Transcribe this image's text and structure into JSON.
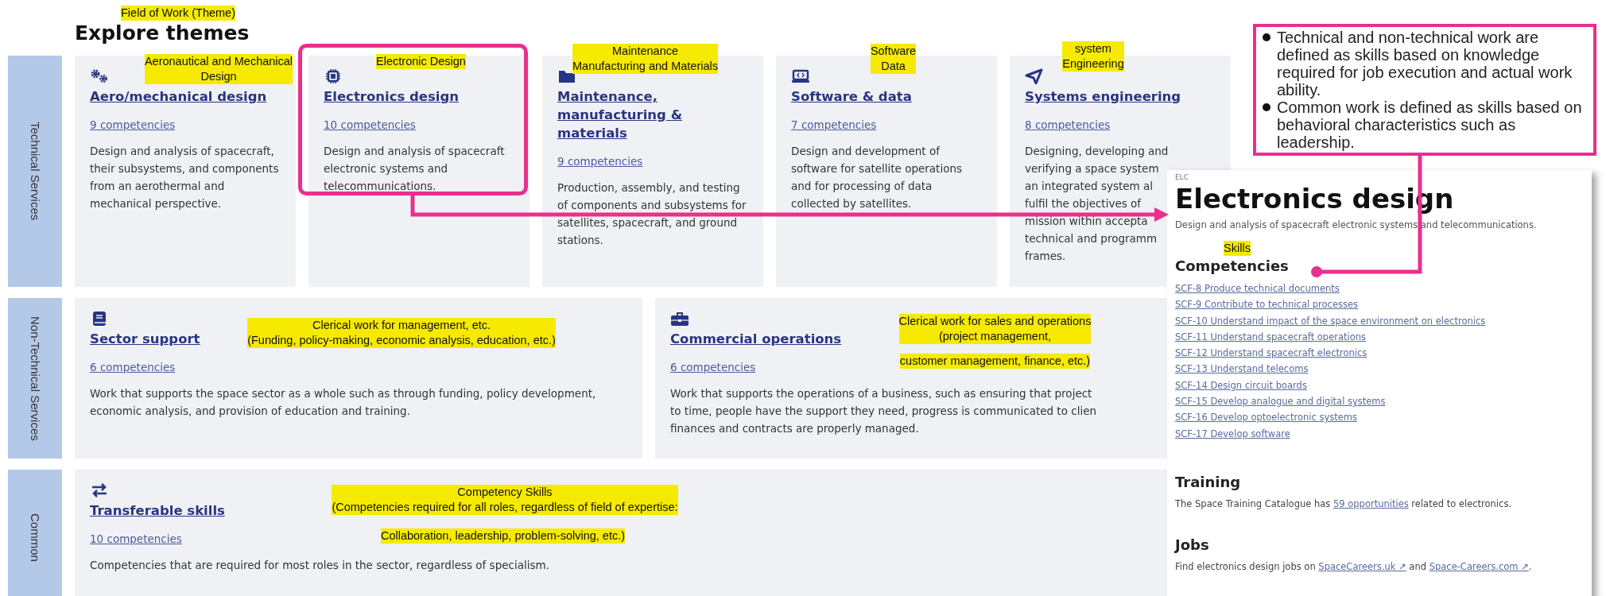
{
  "heading": {
    "title": "Explore themes"
  },
  "groups": [
    {
      "label": "Technical Services",
      "themes": [
        {
          "title": "Aero/mechanical design",
          "competencies": "9 competencies",
          "description": "Design and analysis of spacecraft, their subsystems, and components from an aerothermal and mechanical perspective."
        },
        {
          "title": "Electronics design",
          "competencies": "10 competencies",
          "description": "Design and analysis of spacecraft electronic systems and telecommunications."
        },
        {
          "title": "Maintenance, manufacturing & materials",
          "competencies": "9 competencies",
          "description": "Production, assembly, and testing of components and subsystems for satellites, spacecraft, and ground stations."
        },
        {
          "title": "Software & data",
          "competencies": "7 competencies",
          "description": "Design and development of software for satellite operations and for processing of data collected by satellites."
        },
        {
          "title": "Systems engineering",
          "competencies": "8 competencies",
          "description_lines": [
            "Designing, developing and",
            "verifying a space system",
            "an integrated system al",
            "fulfil the objectives of",
            "mission within accepta",
            "technical and programm",
            "frames."
          ]
        }
      ]
    },
    {
      "label": "Non-Technical Services",
      "themes": [
        {
          "title": "Sector support",
          "competencies": "6 competencies",
          "description": "Work that supports the space sector as a whole such as through funding, policy development, economic analysis, and provision of education and training."
        },
        {
          "title": "Commercial operations",
          "competencies": "6 competencies",
          "description_lines": [
            "Work that supports the operations of a business, such as ensuring that project",
            "to time, people have the support they need, progress is communicated to clien",
            "finances and contracts are properly managed."
          ]
        }
      ]
    },
    {
      "label": "Common",
      "themes": [
        {
          "title": "Transferable skills",
          "competencies": "10 competencies",
          "description": "Competencies that are required for most roles in the sector, regardless of specialism."
        }
      ]
    }
  ],
  "detail_panel": {
    "code": "ELC",
    "title": "Electronics design",
    "description": "Design and analysis of spacecraft electronic systems and telecommunications.",
    "competencies_heading": "Competencies",
    "competencies": [
      "SCF-8 Produce technical documents",
      "SCF-9 Contribute to technical processes",
      "SCF-10 Understand impact of the space environment on electronics",
      "SCF-11 Understand spacecraft operations",
      "SCF-12 Understand spacecraft electronics",
      "SCF-13 Understand telecoms",
      "SCF-14 Design circuit boards",
      "SCF-15 Develop analogue and digital systems",
      "SCF-16 Develop optoelectronic systems",
      "SCF-17 Develop software"
    ],
    "training_heading": "Training",
    "training": {
      "before": "The Space Training Catalogue has ",
      "link": "59 opportunities",
      "after": " related to electronics."
    },
    "jobs_heading": "Jobs",
    "jobs": {
      "before": "Find electronics design jobs on ",
      "links": [
        "SpaceCareers.uk ↗",
        "Space-Careers.com ↗"
      ],
      "between": " and ",
      "after": "."
    }
  },
  "callout": {
    "bullets": [
      "Technical and non-technical work are defined as skills based on knowledge required for job execution and actual work ability.",
      "Common work is defined as skills based on behavioral characteristics such as leadership."
    ]
  },
  "annotations": [
    {
      "text": "Field of Work (Theme)"
    },
    {
      "text": "Aeronautical and Mechanical\nDesign"
    },
    {
      "text": "Electronic Design"
    },
    {
      "text": "Maintenance\nManufacturing and Materials"
    },
    {
      "text": "Software\nData"
    },
    {
      "text": "system\nEngineering"
    },
    {
      "text": "Skills"
    },
    {
      "text": "Clerical work for management, etc.\n(Funding, policy-making, economic analysis, education, etc.)"
    },
    {
      "text": "Clerical work for sales and operations\n(project management,"
    },
    {
      "text": "customer management, finance, etc.)"
    },
    {
      "text": "Competency Skills\n(Competencies required for all roles, regardless of field of expertise:"
    },
    {
      "text": "Collaboration, leadership, problem-solving, etc.)"
    }
  ]
}
